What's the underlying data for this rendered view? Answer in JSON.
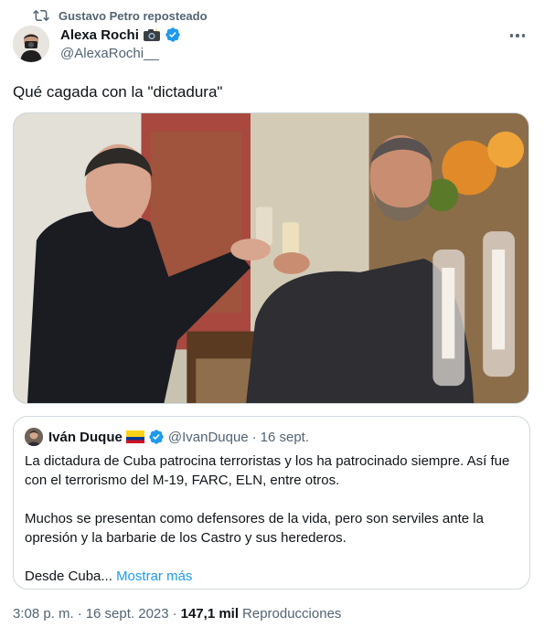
{
  "repost": {
    "label": "Gustavo Petro reposteado"
  },
  "author": {
    "name": "Alexa Rochi",
    "handle": "@AlexaRochi__"
  },
  "tweet": {
    "text": "Qué cagada con la \"dictadura\""
  },
  "quoted": {
    "name": "Iván Duque",
    "handle": "@IvanDuque",
    "separator": "·",
    "date": "16 sept.",
    "paragraphs": [
      "La dictadura de Cuba patrocina terroristas y los ha patrocinado siempre. Así fue con el terrorismo del M-19, FARC, ELN, entre otros.",
      "Muchos se presentan como defensores de la vida, pero son serviles ante la opresión y la barbarie de los Castro y sus herederos."
    ],
    "truncated_text": "Desde Cuba...",
    "show_more": "Mostrar más"
  },
  "meta": {
    "time": "3:08 p. m.",
    "separator": "·",
    "date": "16 sept. 2023",
    "separator2": "·",
    "views": "147,1 mil",
    "views_label": "Reproducciones"
  },
  "colors": {
    "accent": "#1d9bf0",
    "secondary_text": "#536471",
    "border": "#cfd9de"
  },
  "icons": {
    "repost": "repost-icon",
    "verified": "verified-badge-icon",
    "camera": "camera-with-flash-icon",
    "flag": "colombia-flag-icon",
    "more": "more-options-icon"
  }
}
